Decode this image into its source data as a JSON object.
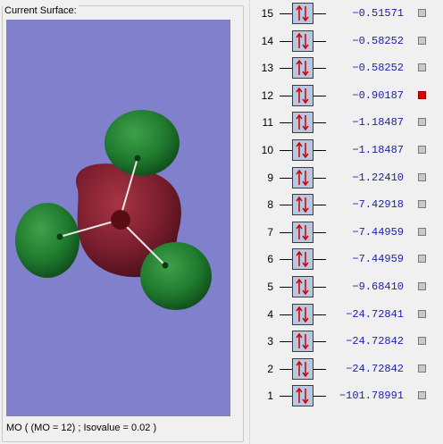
{
  "surface_panel": {
    "group_title": "Current Surface:",
    "status": "MO ( (MO = 12) ; Isovalue = 0.02 )",
    "colors": {
      "background": "#8080cc",
      "positive_lobe": "#1f7a2e",
      "negative_lobe": "#7a1e2e",
      "bond": "#e8e8e8"
    }
  },
  "mo_levels": [
    {
      "index": "15",
      "energy": "−0.51571",
      "selected": false
    },
    {
      "index": "14",
      "energy": "−0.58252",
      "selected": false
    },
    {
      "index": "13",
      "energy": "−0.58252",
      "selected": false
    },
    {
      "index": "12",
      "energy": "−0.90187",
      "selected": true
    },
    {
      "index": "11",
      "energy": "−1.18487",
      "selected": false
    },
    {
      "index": "10",
      "energy": "−1.18487",
      "selected": false
    },
    {
      "index": "9",
      "energy": "−1.22410",
      "selected": false
    },
    {
      "index": "8",
      "energy": "−7.42918",
      "selected": false
    },
    {
      "index": "7",
      "energy": "−7.44959",
      "selected": false
    },
    {
      "index": "6",
      "energy": "−7.44959",
      "selected": false
    },
    {
      "index": "5",
      "energy": "−9.68410",
      "selected": false
    },
    {
      "index": "4",
      "energy": "−24.72841",
      "selected": false
    },
    {
      "index": "3",
      "energy": "−24.72842",
      "selected": false
    },
    {
      "index": "2",
      "energy": "−24.72842",
      "selected": false
    },
    {
      "index": "1",
      "energy": "−101.78991",
      "selected": false
    }
  ],
  "icons": {
    "occupancy": "electron-pair-icon",
    "selection": "checkbox-icon"
  }
}
